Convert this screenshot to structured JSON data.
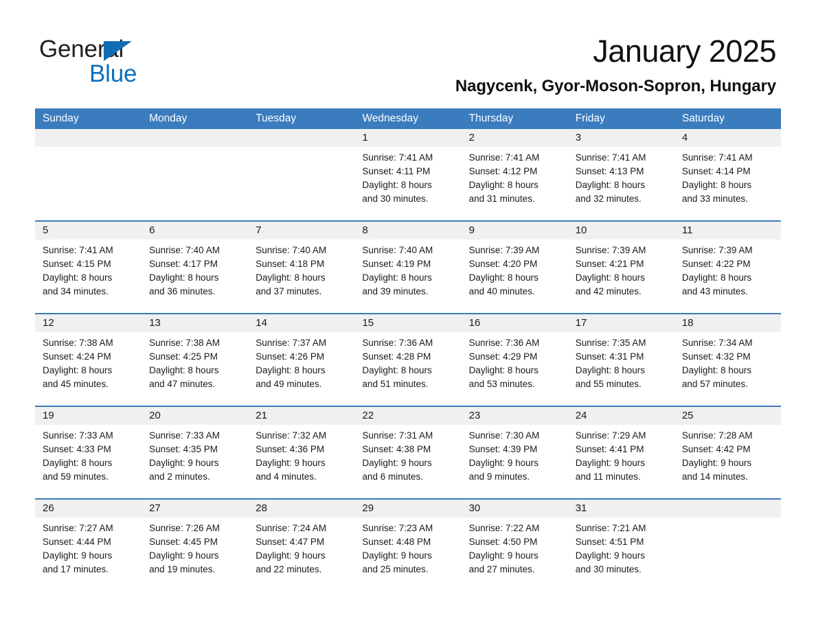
{
  "brand": {
    "name_part1": "General",
    "name_part2": "Blue",
    "accent_color": "#0b6fc0",
    "triangle_color": "#0f6cb5"
  },
  "header": {
    "month_title": "January 2025",
    "location": "Nagycenk, Gyor-Moson-Sopron, Hungary"
  },
  "calendar": {
    "header_bg": "#3a7cbe",
    "day_band_bg": "#f0f0f0",
    "day_of_week": [
      "Sunday",
      "Monday",
      "Tuesday",
      "Wednesday",
      "Thursday",
      "Friday",
      "Saturday"
    ],
    "weeks": [
      [
        {
          "day": "",
          "sunrise": "",
          "sunset": "",
          "daylight": "",
          "daylight2": "",
          "empty": true
        },
        {
          "day": "",
          "sunrise": "",
          "sunset": "",
          "daylight": "",
          "daylight2": "",
          "empty": true
        },
        {
          "day": "",
          "sunrise": "",
          "sunset": "",
          "daylight": "",
          "daylight2": "",
          "empty": true
        },
        {
          "day": "1",
          "sunrise": "Sunrise: 7:41 AM",
          "sunset": "Sunset: 4:11 PM",
          "daylight": "Daylight: 8 hours",
          "daylight2": "and 30 minutes."
        },
        {
          "day": "2",
          "sunrise": "Sunrise: 7:41 AM",
          "sunset": "Sunset: 4:12 PM",
          "daylight": "Daylight: 8 hours",
          "daylight2": "and 31 minutes."
        },
        {
          "day": "3",
          "sunrise": "Sunrise: 7:41 AM",
          "sunset": "Sunset: 4:13 PM",
          "daylight": "Daylight: 8 hours",
          "daylight2": "and 32 minutes."
        },
        {
          "day": "4",
          "sunrise": "Sunrise: 7:41 AM",
          "sunset": "Sunset: 4:14 PM",
          "daylight": "Daylight: 8 hours",
          "daylight2": "and 33 minutes."
        }
      ],
      [
        {
          "day": "5",
          "sunrise": "Sunrise: 7:41 AM",
          "sunset": "Sunset: 4:15 PM",
          "daylight": "Daylight: 8 hours",
          "daylight2": "and 34 minutes."
        },
        {
          "day": "6",
          "sunrise": "Sunrise: 7:40 AM",
          "sunset": "Sunset: 4:17 PM",
          "daylight": "Daylight: 8 hours",
          "daylight2": "and 36 minutes."
        },
        {
          "day": "7",
          "sunrise": "Sunrise: 7:40 AM",
          "sunset": "Sunset: 4:18 PM",
          "daylight": "Daylight: 8 hours",
          "daylight2": "and 37 minutes."
        },
        {
          "day": "8",
          "sunrise": "Sunrise: 7:40 AM",
          "sunset": "Sunset: 4:19 PM",
          "daylight": "Daylight: 8 hours",
          "daylight2": "and 39 minutes."
        },
        {
          "day": "9",
          "sunrise": "Sunrise: 7:39 AM",
          "sunset": "Sunset: 4:20 PM",
          "daylight": "Daylight: 8 hours",
          "daylight2": "and 40 minutes."
        },
        {
          "day": "10",
          "sunrise": "Sunrise: 7:39 AM",
          "sunset": "Sunset: 4:21 PM",
          "daylight": "Daylight: 8 hours",
          "daylight2": "and 42 minutes."
        },
        {
          "day": "11",
          "sunrise": "Sunrise: 7:39 AM",
          "sunset": "Sunset: 4:22 PM",
          "daylight": "Daylight: 8 hours",
          "daylight2": "and 43 minutes."
        }
      ],
      [
        {
          "day": "12",
          "sunrise": "Sunrise: 7:38 AM",
          "sunset": "Sunset: 4:24 PM",
          "daylight": "Daylight: 8 hours",
          "daylight2": "and 45 minutes."
        },
        {
          "day": "13",
          "sunrise": "Sunrise: 7:38 AM",
          "sunset": "Sunset: 4:25 PM",
          "daylight": "Daylight: 8 hours",
          "daylight2": "and 47 minutes."
        },
        {
          "day": "14",
          "sunrise": "Sunrise: 7:37 AM",
          "sunset": "Sunset: 4:26 PM",
          "daylight": "Daylight: 8 hours",
          "daylight2": "and 49 minutes."
        },
        {
          "day": "15",
          "sunrise": "Sunrise: 7:36 AM",
          "sunset": "Sunset: 4:28 PM",
          "daylight": "Daylight: 8 hours",
          "daylight2": "and 51 minutes."
        },
        {
          "day": "16",
          "sunrise": "Sunrise: 7:36 AM",
          "sunset": "Sunset: 4:29 PM",
          "daylight": "Daylight: 8 hours",
          "daylight2": "and 53 minutes."
        },
        {
          "day": "17",
          "sunrise": "Sunrise: 7:35 AM",
          "sunset": "Sunset: 4:31 PM",
          "daylight": "Daylight: 8 hours",
          "daylight2": "and 55 minutes."
        },
        {
          "day": "18",
          "sunrise": "Sunrise: 7:34 AM",
          "sunset": "Sunset: 4:32 PM",
          "daylight": "Daylight: 8 hours",
          "daylight2": "and 57 minutes."
        }
      ],
      [
        {
          "day": "19",
          "sunrise": "Sunrise: 7:33 AM",
          "sunset": "Sunset: 4:33 PM",
          "daylight": "Daylight: 8 hours",
          "daylight2": "and 59 minutes."
        },
        {
          "day": "20",
          "sunrise": "Sunrise: 7:33 AM",
          "sunset": "Sunset: 4:35 PM",
          "daylight": "Daylight: 9 hours",
          "daylight2": "and 2 minutes."
        },
        {
          "day": "21",
          "sunrise": "Sunrise: 7:32 AM",
          "sunset": "Sunset: 4:36 PM",
          "daylight": "Daylight: 9 hours",
          "daylight2": "and 4 minutes."
        },
        {
          "day": "22",
          "sunrise": "Sunrise: 7:31 AM",
          "sunset": "Sunset: 4:38 PM",
          "daylight": "Daylight: 9 hours",
          "daylight2": "and 6 minutes."
        },
        {
          "day": "23",
          "sunrise": "Sunrise: 7:30 AM",
          "sunset": "Sunset: 4:39 PM",
          "daylight": "Daylight: 9 hours",
          "daylight2": "and 9 minutes."
        },
        {
          "day": "24",
          "sunrise": "Sunrise: 7:29 AM",
          "sunset": "Sunset: 4:41 PM",
          "daylight": "Daylight: 9 hours",
          "daylight2": "and 11 minutes."
        },
        {
          "day": "25",
          "sunrise": "Sunrise: 7:28 AM",
          "sunset": "Sunset: 4:42 PM",
          "daylight": "Daylight: 9 hours",
          "daylight2": "and 14 minutes."
        }
      ],
      [
        {
          "day": "26",
          "sunrise": "Sunrise: 7:27 AM",
          "sunset": "Sunset: 4:44 PM",
          "daylight": "Daylight: 9 hours",
          "daylight2": "and 17 minutes."
        },
        {
          "day": "27",
          "sunrise": "Sunrise: 7:26 AM",
          "sunset": "Sunset: 4:45 PM",
          "daylight": "Daylight: 9 hours",
          "daylight2": "and 19 minutes."
        },
        {
          "day": "28",
          "sunrise": "Sunrise: 7:24 AM",
          "sunset": "Sunset: 4:47 PM",
          "daylight": "Daylight: 9 hours",
          "daylight2": "and 22 minutes."
        },
        {
          "day": "29",
          "sunrise": "Sunrise: 7:23 AM",
          "sunset": "Sunset: 4:48 PM",
          "daylight": "Daylight: 9 hours",
          "daylight2": "and 25 minutes."
        },
        {
          "day": "30",
          "sunrise": "Sunrise: 7:22 AM",
          "sunset": "Sunset: 4:50 PM",
          "daylight": "Daylight: 9 hours",
          "daylight2": "and 27 minutes."
        },
        {
          "day": "31",
          "sunrise": "Sunrise: 7:21 AM",
          "sunset": "Sunset: 4:51 PM",
          "daylight": "Daylight: 9 hours",
          "daylight2": "and 30 minutes."
        },
        {
          "day": "",
          "sunrise": "",
          "sunset": "",
          "daylight": "",
          "daylight2": "",
          "empty": true
        }
      ]
    ]
  }
}
